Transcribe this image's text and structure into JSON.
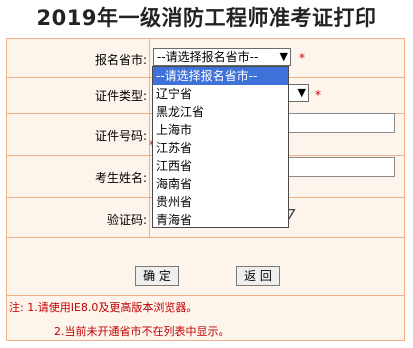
{
  "page": {
    "title": "2019年一级消防工程师准考证打印"
  },
  "form": {
    "province": {
      "label": "报名省市:",
      "selected": "--请选择报名省市--",
      "arrow": "▼",
      "required_mark": "*",
      "options": [
        "--请选择报名省市--",
        "辽宁省",
        "黑龙江省",
        "上海市",
        "江苏省",
        "江西省",
        "海南省",
        "贵州省",
        "青海省"
      ]
    },
    "cert_type": {
      "label": "证件类型:",
      "arrow": "▼",
      "required_mark": "*"
    },
    "cert_number": {
      "label": "证件号码:",
      "required_mark": "*"
    },
    "name": {
      "label": "考生姓名:"
    },
    "captcha": {
      "label": "验证码:",
      "image_text": "7"
    },
    "buttons": {
      "confirm": "确 定",
      "back": "返 回"
    }
  },
  "notes": {
    "line1": "注: 1.请使用IE8.0及更高版本浏览器。",
    "line2": "2.当前未开通省市不在列表中显示。"
  },
  "colors": {
    "border": "#f0b08a",
    "background": "#fdf5ec",
    "required": "#d40000",
    "selected_option": "#3f72d8"
  }
}
